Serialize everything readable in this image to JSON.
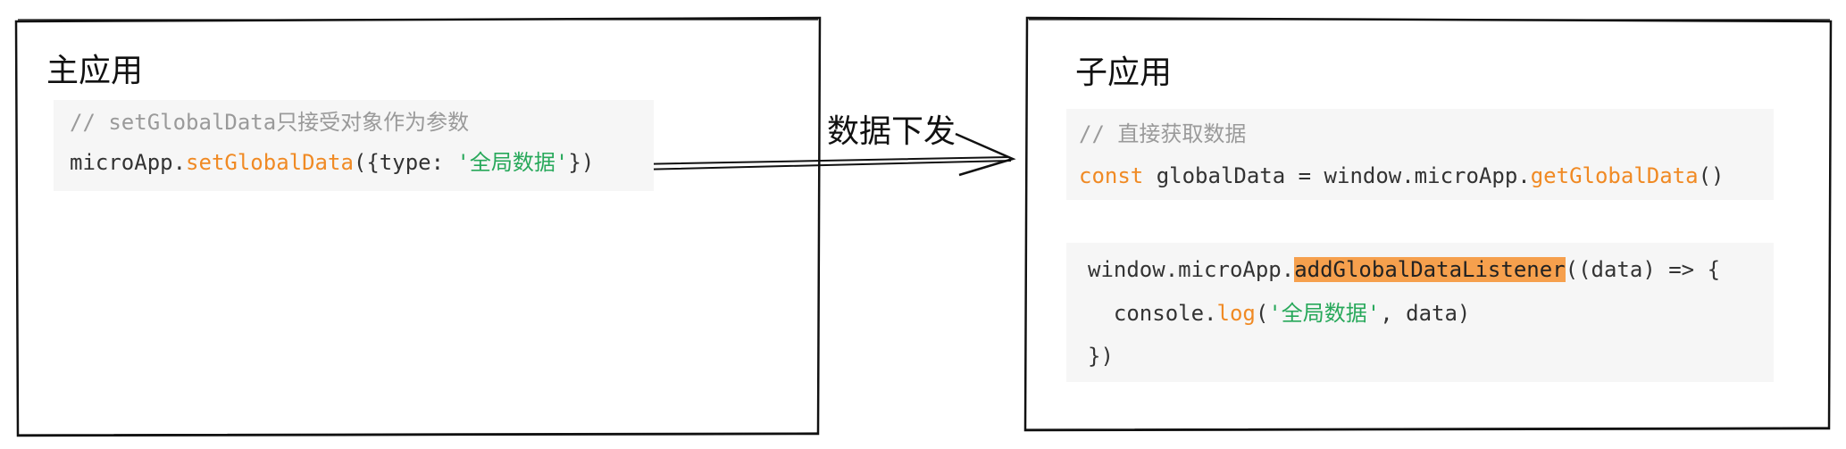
{
  "main_app": {
    "title": "主应用",
    "code": {
      "comment": "// setGlobalData只接受对象作为参数",
      "line_prefix": "microApp.",
      "fn": "setGlobalData",
      "args_open": "({type: ",
      "str": "'全局数据'",
      "args_close": "})"
    }
  },
  "edge": {
    "label": "数据下发"
  },
  "sub_app": {
    "title": "子应用",
    "code1": {
      "comment": "// 直接获取数据",
      "kw": "const",
      "mid": " globalData = window.microApp.",
      "fn": "getGlobalData",
      "tail": "()"
    },
    "code2": {
      "line1_prefix": "window.microApp.",
      "line1_fn": "addGlobalDataListener",
      "line1_tail": "((data) => {",
      "line2_prefix": "  console.",
      "line2_fn": "log",
      "line2_open": "(",
      "line2_str": "'全局数据'",
      "line2_tail": ", data)",
      "line3": "})"
    }
  },
  "colors": {
    "keyword": "#f08a24",
    "string": "#27a85a",
    "comment": "#9a9a9a",
    "highlight": "#f6a04d",
    "code_bg": "#f6f6f6"
  }
}
